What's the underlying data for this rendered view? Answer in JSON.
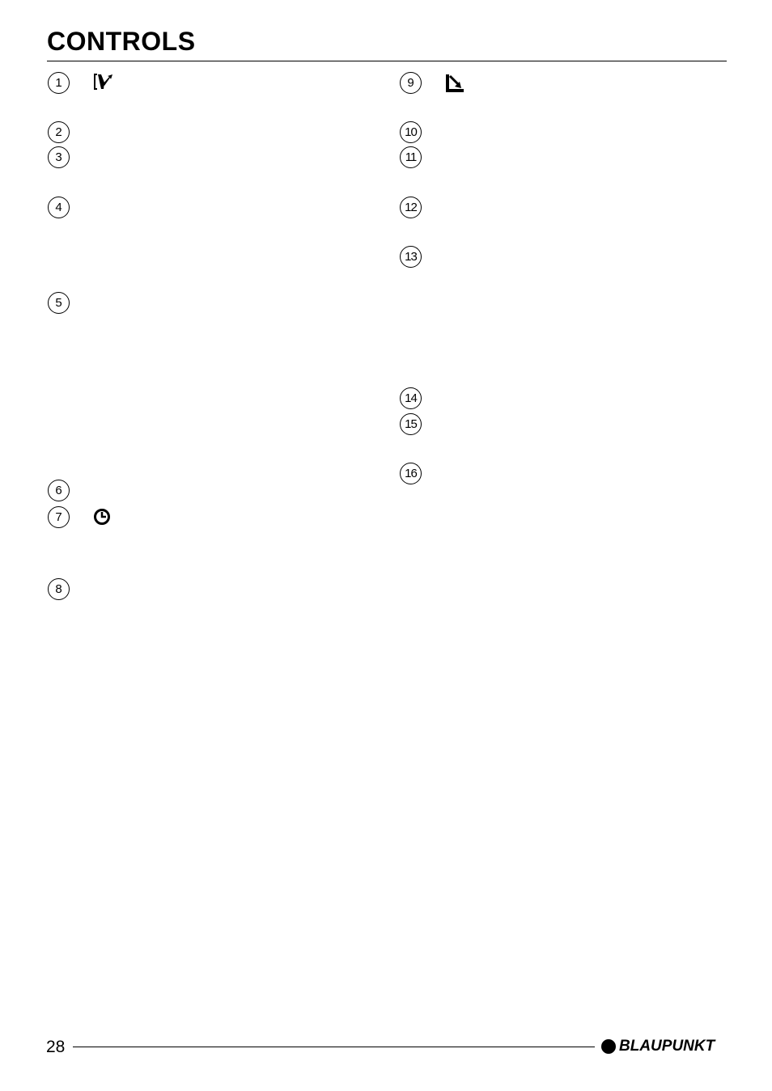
{
  "page": {
    "title": "CONTROLS",
    "page_number": "28",
    "brand": "BLAUPUNKT"
  },
  "left_column": {
    "items": [
      {
        "number": "1",
        "icon": "front-panel-release-icon"
      },
      {
        "number": "2"
      },
      {
        "number": "3"
      },
      {
        "number": "4"
      },
      {
        "number": "5"
      },
      {
        "number": "6"
      },
      {
        "number": "7",
        "icon": "clock-icon"
      },
      {
        "number": "8"
      }
    ]
  },
  "right_column": {
    "items": [
      {
        "number": "9",
        "icon": "eject-arrow-icon"
      },
      {
        "number": "10"
      },
      {
        "number": "11"
      },
      {
        "number": "12"
      },
      {
        "number": "13"
      },
      {
        "number": "14"
      },
      {
        "number": "15"
      },
      {
        "number": "16"
      }
    ]
  }
}
